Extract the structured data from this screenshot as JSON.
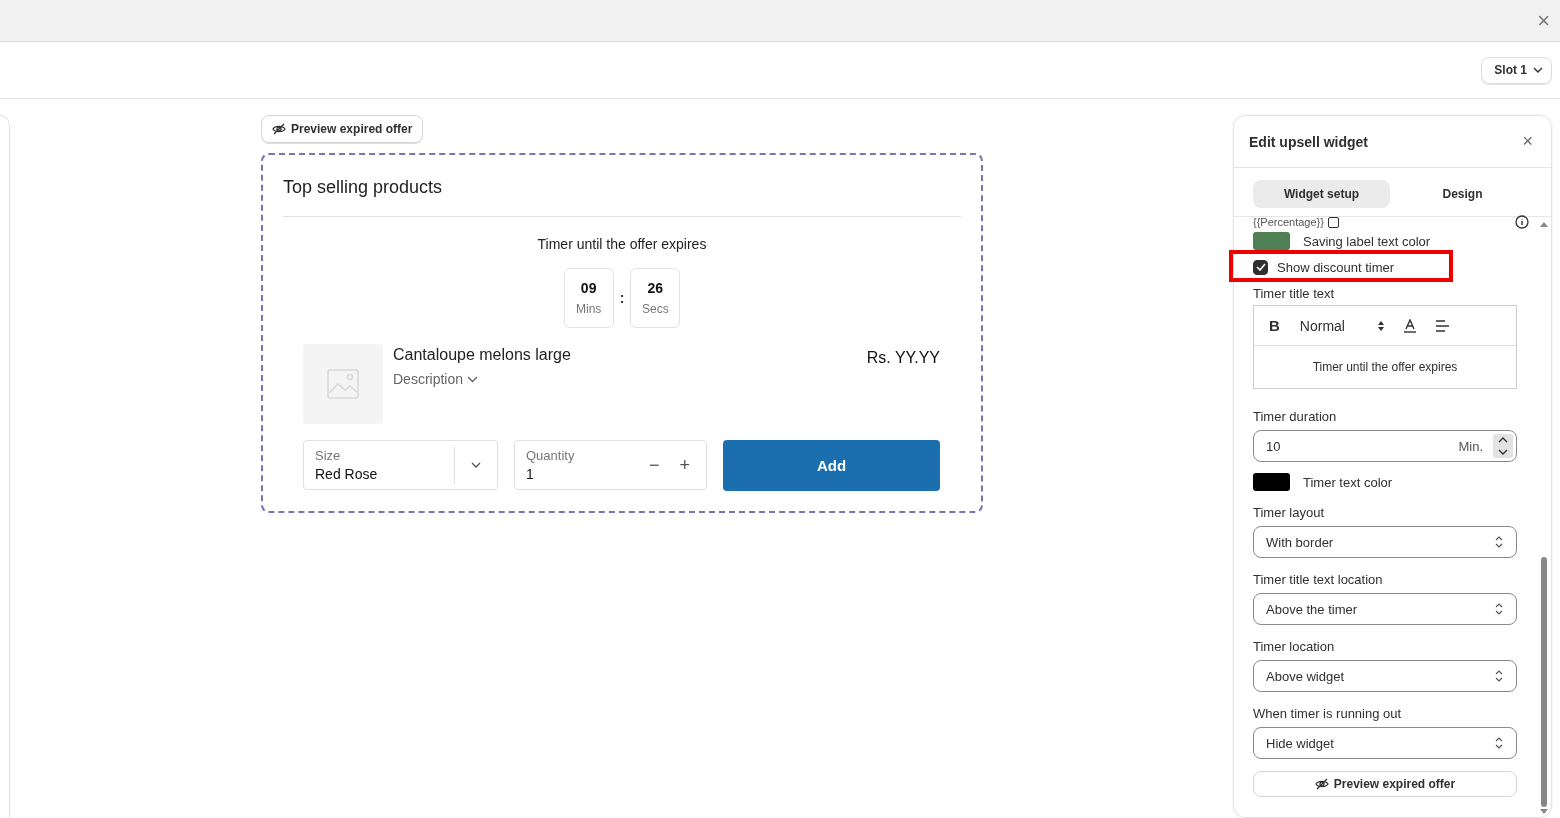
{
  "top_bar": {
    "close": "×"
  },
  "toolbar": {
    "slot": "Slot 1"
  },
  "preview": {
    "expired_button": "Preview expired offer",
    "widget": {
      "title": "Top selling products",
      "timer_title": "Timer until the offer expires",
      "timer": [
        {
          "value": "09",
          "unit": "Mins"
        },
        {
          "value": "26",
          "unit": "Secs"
        }
      ],
      "separator": ":",
      "product": {
        "name": "Cantaloupe melons large",
        "description": "Description",
        "price": "Rs. YY.YY"
      },
      "size": {
        "label": "Size",
        "value": "Red Rose"
      },
      "quantity": {
        "label": "Quantity",
        "value": "1",
        "minus": "−",
        "plus": "+"
      },
      "add_button": "Add"
    }
  },
  "panel": {
    "title": "Edit upsell widget",
    "close": "×",
    "tabs": [
      {
        "label": "Widget setup",
        "selected": true
      },
      {
        "label": "Design",
        "selected": false
      }
    ],
    "percentage_text": "{{Percentage}}",
    "percentage_checked": false,
    "saving_color": {
      "label": "Saving label text color",
      "color": "#4f7f55"
    },
    "show_timer": {
      "label": "Show discount timer",
      "checked": true
    },
    "timer_title": {
      "label": "Timer title text",
      "bold": "B",
      "size": "Normal",
      "content": "Timer until the offer expires"
    },
    "duration": {
      "label": "Timer duration",
      "value": "10",
      "unit": "Min."
    },
    "timer_color": {
      "label": "Timer text color",
      "color": "#000000"
    },
    "selects": [
      {
        "label": "Timer layout",
        "value": "With border"
      },
      {
        "label": "Timer title text location",
        "value": "Above the timer"
      },
      {
        "label": "Timer location",
        "value": "Above widget"
      },
      {
        "label": "When timer is running out",
        "value": "Hide widget"
      }
    ],
    "preview_button": "Preview expired offer"
  }
}
